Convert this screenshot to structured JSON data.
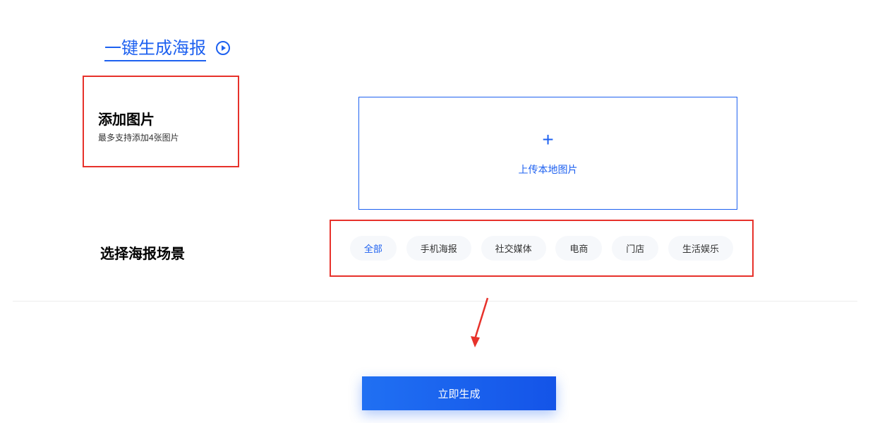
{
  "header": {
    "title": "一键生成海报"
  },
  "addImage": {
    "title": "添加图片",
    "subtitle": "最多支持添加4张图片"
  },
  "upload": {
    "text": "上传本地图片"
  },
  "scene": {
    "label": "选择海报场景",
    "options": [
      "全部",
      "手机海报",
      "社交媒体",
      "电商",
      "门店",
      "生活娱乐"
    ]
  },
  "generate": {
    "label": "立即生成"
  }
}
